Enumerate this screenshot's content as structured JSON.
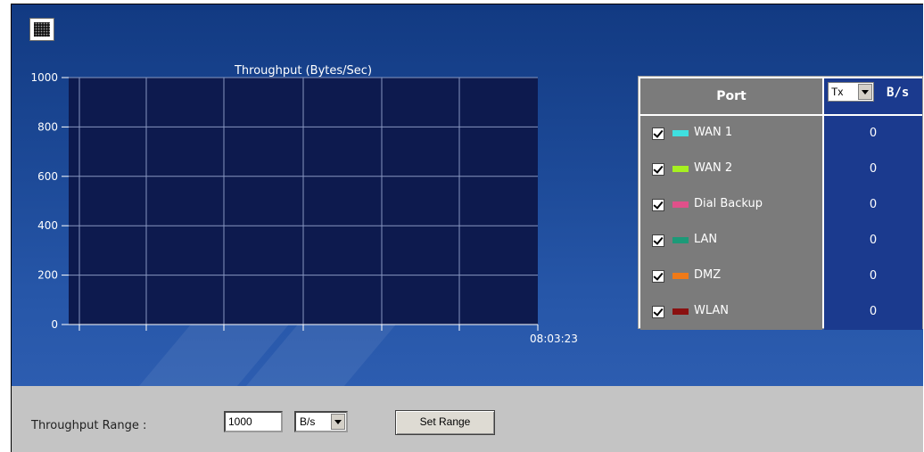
{
  "toolbar": {
    "icon": "grid-icon"
  },
  "chart_data": {
    "type": "line",
    "title": "Throughput (Bytes/Sec)",
    "xlabel": "",
    "ylabel": "",
    "ylim": [
      0,
      1000
    ],
    "y_ticks": [
      "1000",
      "800",
      "600",
      "400",
      "200",
      "0"
    ],
    "x_tick_labels": [
      "08:03:23"
    ],
    "grid": true,
    "background": "#0d1a4e",
    "series": [
      {
        "name": "WAN 1",
        "values": []
      },
      {
        "name": "WAN 2",
        "values": []
      },
      {
        "name": "Dial Backup",
        "values": []
      },
      {
        "name": "LAN",
        "values": []
      },
      {
        "name": "DMZ",
        "values": []
      },
      {
        "name": "WLAN",
        "values": []
      }
    ]
  },
  "port_table": {
    "header_port": "Port",
    "direction_select": "Tx",
    "unit_label": "B/s",
    "rows": [
      {
        "name": "WAN 1",
        "color": "#3fe0e0",
        "checked": true,
        "value": "0"
      },
      {
        "name": "WAN 2",
        "color": "#a6f020",
        "checked": true,
        "value": "0"
      },
      {
        "name": "Dial Backup",
        "color": "#e0508a",
        "checked": true,
        "value": "0"
      },
      {
        "name": "LAN",
        "color": "#1c9a78",
        "checked": true,
        "value": "0"
      },
      {
        "name": "DMZ",
        "color": "#f07a18",
        "checked": true,
        "value": "0"
      },
      {
        "name": "WLAN",
        "color": "#8a1010",
        "checked": true,
        "value": "0"
      }
    ]
  },
  "range": {
    "label": "Throughput Range :",
    "value": "1000",
    "unit": "B/s",
    "button": "Set Range"
  }
}
